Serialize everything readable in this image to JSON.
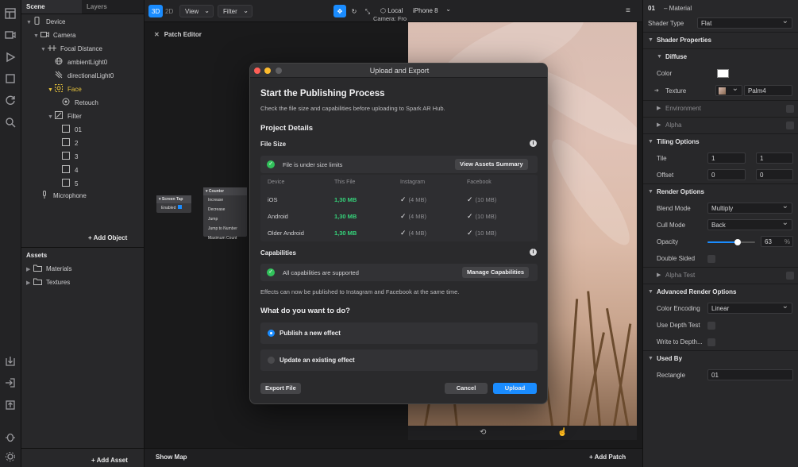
{
  "scene_panel": {
    "tabs": [
      "Scene",
      "Layers"
    ],
    "tree": [
      {
        "label": "Device"
      },
      {
        "label": "Camera"
      },
      {
        "label": "Focal Distance"
      },
      {
        "label": "ambientLight0"
      },
      {
        "label": "directionalLight0"
      },
      {
        "label": "Face"
      },
      {
        "label": "Retouch"
      },
      {
        "label": "Filter"
      },
      {
        "label": "01"
      },
      {
        "label": "2"
      },
      {
        "label": "3"
      },
      {
        "label": "4"
      },
      {
        "label": "5"
      },
      {
        "label": "Microphone"
      }
    ],
    "add_object": "Add Object",
    "assets_title": "Assets",
    "assets": [
      "Materials",
      "Textures"
    ],
    "add_asset": "Add Asset"
  },
  "toolbar": {
    "mode_3d": "3D",
    "mode_2d": "2D",
    "view": "View",
    "filter": "Filter",
    "local": "Local",
    "device": "iPhone 8",
    "camera_label": "Camera: Fro"
  },
  "patch_editor": {
    "title": "Patch Editor",
    "show_map": "Show Map",
    "add_patch": "Add Patch",
    "nodes": {
      "screen_tap": {
        "title": "Screen Tap",
        "port": "Enabled"
      },
      "counter": {
        "title": "Counter",
        "ports": [
          "Increase",
          "Decrease",
          "Jump",
          "Jump to Number",
          "Maximum Count"
        ]
      }
    }
  },
  "dialog": {
    "title": "Upload and Export",
    "heading": "Start the Publishing Process",
    "subheading": "Check the file size and capabilities before uploading to Spark AR Hub.",
    "project_details": "Project Details",
    "file_size": "File Size",
    "size_status": "File is under size limits",
    "view_assets": "View Assets Summary",
    "table_headers": [
      "Device",
      "This File",
      "Instagram",
      "Facebook"
    ],
    "rows": [
      {
        "device": "iOS",
        "size": "1,30 MB",
        "instagram": "(4 MB)",
        "facebook": "(10 MB)"
      },
      {
        "device": "Android",
        "size": "1,30 MB",
        "instagram": "(4 MB)",
        "facebook": "(10 MB)"
      },
      {
        "device": "Older Android",
        "size": "1,30 MB",
        "instagram": "(4 MB)",
        "facebook": "(10 MB)"
      }
    ],
    "capabilities": "Capabilities",
    "cap_status": "All capabilities are supported",
    "manage_caps": "Manage Capabilities",
    "cap_note": "Effects can now be published to Instagram and Facebook at the same time.",
    "question": "What do you want to do?",
    "option_publish": "Publish a new effect",
    "option_update": "Update an existing effect",
    "export_file": "Export File",
    "cancel": "Cancel",
    "upload": "Upload"
  },
  "inspector": {
    "material_id": "01",
    "material_type": "– Material",
    "shader_type_label": "Shader Type",
    "shader_type_value": "Flat",
    "shader_properties": "Shader Properties",
    "diffuse": "Diffuse",
    "color_label": "Color",
    "texture_label": "Texture",
    "texture_value": "Palm4",
    "environment": "Environment",
    "alpha": "Alpha",
    "tiling_options": "Tiling Options",
    "tile_label": "Tile",
    "tile_x": "1",
    "tile_y": "1",
    "offset_label": "Offset",
    "offset_x": "0",
    "offset_y": "0",
    "render_options": "Render Options",
    "blend_mode_label": "Blend Mode",
    "blend_mode_value": "Multiply",
    "cull_mode_label": "Cull Mode",
    "cull_mode_value": "Back",
    "opacity_label": "Opacity",
    "opacity_value": "63",
    "opacity_unit": "%",
    "opacity_fraction": 0.63,
    "double_sided_label": "Double Sided",
    "alpha_test": "Alpha Test",
    "advanced_render_options": "Advanced Render Options",
    "color_encoding_label": "Color Encoding",
    "color_encoding_value": "Linear",
    "use_depth_test_label": "Use Depth Test",
    "write_depth_label": "Write to Depth...",
    "used_by": "Used By",
    "used_by_label": "Rectangle",
    "used_by_value": "01"
  },
  "colors": {
    "accent": "#1a8cff",
    "success": "#31c15a",
    "face_yellow": "#e6c23c"
  }
}
